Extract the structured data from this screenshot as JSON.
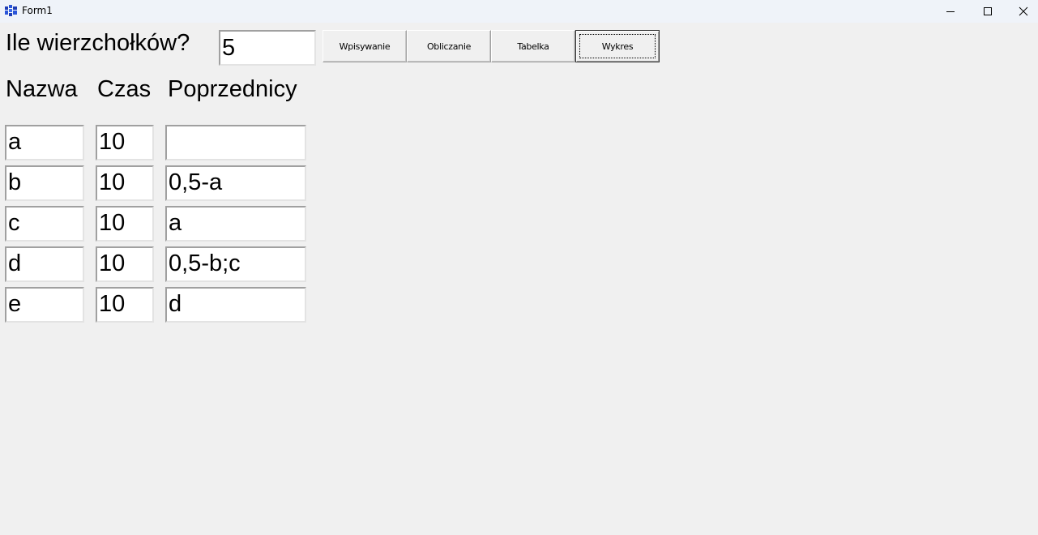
{
  "window": {
    "title": "Form1",
    "icon": "app-icon",
    "controls": [
      "minimize-icon",
      "maximize-icon",
      "close-icon"
    ]
  },
  "form": {
    "question_label": "Ile wierzchołków?",
    "count_value": "5",
    "buttons": {
      "wpisywanie": "Wpisywanie",
      "obliczanie": "Obliczanie",
      "tabelka": "Tabelka",
      "wykres": "Wykres"
    },
    "headers": {
      "nazwa": "Nazwa",
      "czas": "Czas",
      "poprzednicy": "Poprzednicy"
    },
    "rows": [
      {
        "nazwa": "a",
        "czas": "10",
        "poprzednicy": ""
      },
      {
        "nazwa": "b",
        "czas": "10",
        "poprzednicy": "0,5-a"
      },
      {
        "nazwa": "c",
        "czas": "10",
        "poprzednicy": "a"
      },
      {
        "nazwa": "d",
        "czas": "10",
        "poprzednicy": "0,5-b;c"
      },
      {
        "nazwa": "e",
        "czas": "10",
        "poprzednicy": "d"
      }
    ]
  }
}
